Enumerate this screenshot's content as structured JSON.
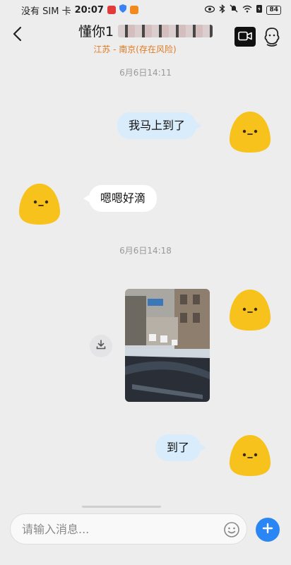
{
  "status_bar": {
    "carrier": "没有 SIM 卡",
    "time": "20:07",
    "battery": "84"
  },
  "header": {
    "back_icon": "chevron-left-icon",
    "title": "懂你1",
    "subtitle": "江苏 - 南京(存在风险)",
    "video_icon": "video-call-icon",
    "profile_icon": "contact-profile-icon"
  },
  "messages": [
    {
      "type": "timestamp",
      "text": "6月6日14:11"
    },
    {
      "type": "text",
      "direction": "out",
      "text": "我马上到了"
    },
    {
      "type": "text",
      "direction": "in",
      "text": "嗯嗯好滴"
    },
    {
      "type": "timestamp",
      "text": "6月6日14:18"
    },
    {
      "type": "image",
      "direction": "out",
      "download_icon": "download-icon"
    },
    {
      "type": "text",
      "direction": "out",
      "text": "到了"
    }
  ],
  "input": {
    "placeholder": "请输入消息...",
    "emoji_icon": "emoji-icon",
    "plus_icon": "plus-icon"
  },
  "colors": {
    "background": "#ededee",
    "outgoing_bubble": "#d9ecfb",
    "incoming_bubble": "#ffffff",
    "subtitle": "#e07a1e",
    "accent": "#2b86f5",
    "avatar": "#f7c21c"
  }
}
